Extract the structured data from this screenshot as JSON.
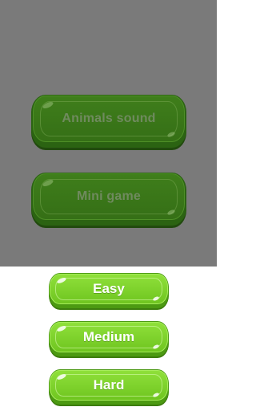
{
  "menu": {
    "animals_sound_label": "Animals sound",
    "mini_game_label": "Mini game"
  },
  "difficulty": {
    "easy_label": "Easy",
    "medium_label": "Medium",
    "hard_label": "Hard"
  },
  "colors": {
    "overlay": "#7a7a7a",
    "button_green": "#7ed42e",
    "button_dark_green": "#356f16",
    "label_white": "#ffffff"
  }
}
